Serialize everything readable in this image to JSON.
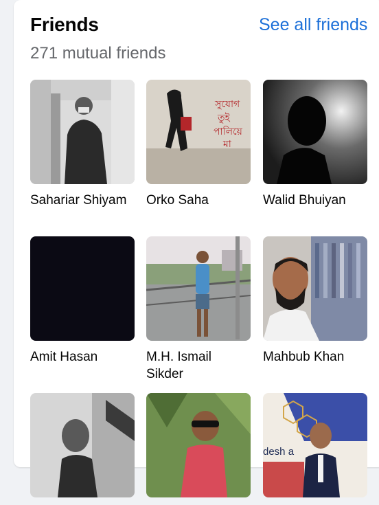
{
  "header": {
    "title": "Friends",
    "see_all_label": "See all friends",
    "mutual_count": "271 mutual friends"
  },
  "friends": [
    {
      "name": "Sahariar Shiyam"
    },
    {
      "name": "Orko Saha"
    },
    {
      "name": "Walid Bhuiyan"
    },
    {
      "name": "Amit Hasan"
    },
    {
      "name": "M.H. Ismail Sikder"
    },
    {
      "name": "Mahbub Khan"
    },
    {
      "name": ""
    },
    {
      "name": ""
    },
    {
      "name": ""
    }
  ],
  "colors": {
    "link": "#1b6fd8",
    "title": "#050505",
    "muted": "#65676b",
    "background": "#f0f2f5"
  }
}
